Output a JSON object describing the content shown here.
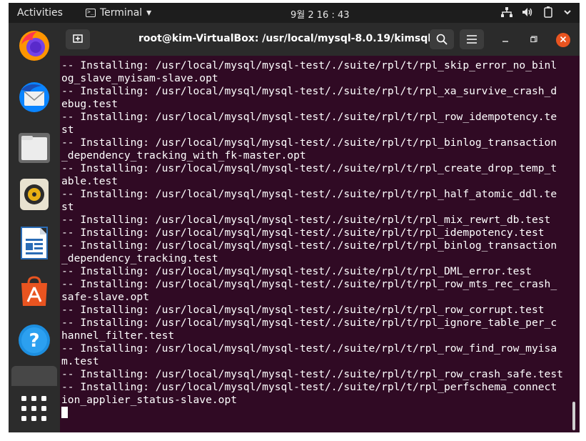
{
  "topbar": {
    "activities": "Activities",
    "app_name": "Terminal",
    "app_menu_arrow": "▾",
    "clock": "9월 2  16 : 43",
    "tray_icons": [
      "network-icon",
      "volume-icon",
      "battery-icon",
      "power-icon"
    ]
  },
  "dock": {
    "items": [
      "firefox",
      "thunderbird",
      "files",
      "rhythmbox",
      "libreoffice-writer",
      "ubuntu-software",
      "help",
      "terminal",
      "show-applications"
    ]
  },
  "window": {
    "title": "root@kim-VirtualBox: /usr/local/mysql-8.0.19/kimsql"
  },
  "terminal": {
    "lines": [
      "-- Installing: /usr/local/mysql/mysql-test/./suite/rpl/t/rpl_skip_error_no_binl",
      "og_slave_myisam-slave.opt",
      "-- Installing: /usr/local/mysql/mysql-test/./suite/rpl/t/rpl_xa_survive_crash_d",
      "ebug.test",
      "-- Installing: /usr/local/mysql/mysql-test/./suite/rpl/t/rpl_row_idempotency.te",
      "st",
      "-- Installing: /usr/local/mysql/mysql-test/./suite/rpl/t/rpl_binlog_transaction",
      "_dependency_tracking_with_fk-master.opt",
      "-- Installing: /usr/local/mysql/mysql-test/./suite/rpl/t/rpl_create_drop_temp_t",
      "able.test",
      "-- Installing: /usr/local/mysql/mysql-test/./suite/rpl/t/rpl_half_atomic_ddl.te",
      "st",
      "-- Installing: /usr/local/mysql/mysql-test/./suite/rpl/t/rpl_mix_rewrt_db.test",
      "-- Installing: /usr/local/mysql/mysql-test/./suite/rpl/t/rpl_idempotency.test",
      "-- Installing: /usr/local/mysql/mysql-test/./suite/rpl/t/rpl_binlog_transaction",
      "_dependency_tracking.test",
      "-- Installing: /usr/local/mysql/mysql-test/./suite/rpl/t/rpl_DML_error.test",
      "-- Installing: /usr/local/mysql/mysql-test/./suite/rpl/t/rpl_row_mts_rec_crash_",
      "safe-slave.opt",
      "-- Installing: /usr/local/mysql/mysql-test/./suite/rpl/t/rpl_row_corrupt.test",
      "-- Installing: /usr/local/mysql/mysql-test/./suite/rpl/t/rpl_ignore_table_per_c",
      "hannel_filter.test",
      "-- Installing: /usr/local/mysql/mysql-test/./suite/rpl/t/rpl_row_find_row_myisa",
      "m.test",
      "-- Installing: /usr/local/mysql/mysql-test/./suite/rpl/t/rpl_row_crash_safe.test",
      "-- Installing: /usr/local/mysql/mysql-test/./suite/rpl/t/rpl_perfschema_connect",
      "ion_applier_status-slave.opt"
    ]
  }
}
